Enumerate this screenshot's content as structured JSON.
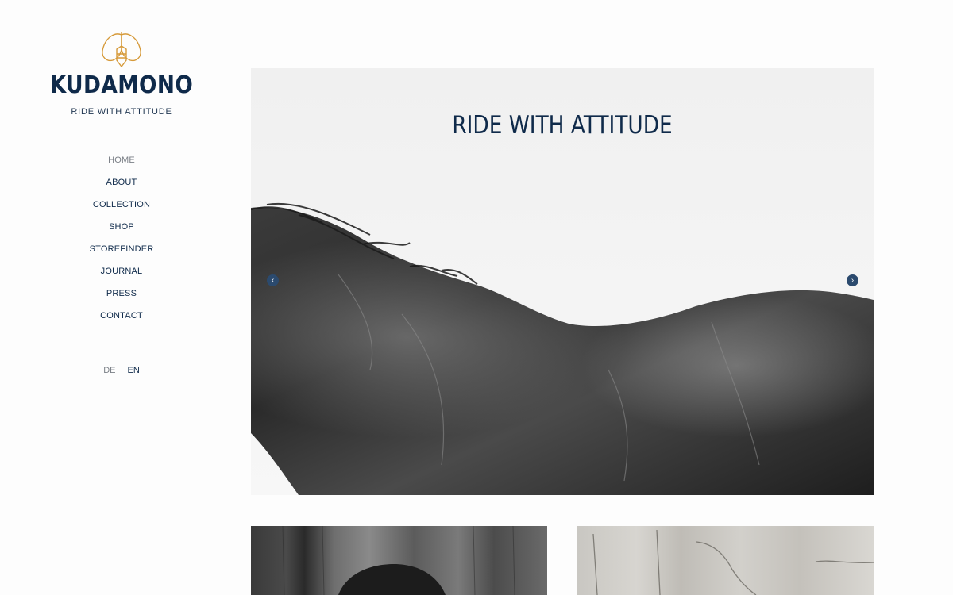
{
  "brand": {
    "name": "KUDAMONO",
    "tagline": "RIDE WITH ATTITUDE",
    "logo_icon": "bee-logo-icon",
    "logo_color": "#d69a3a",
    "brand_color": "#0f2a4a"
  },
  "nav": {
    "items": [
      {
        "label": "HOME",
        "active": true
      },
      {
        "label": "ABOUT"
      },
      {
        "label": "COLLECTION"
      },
      {
        "label": "SHOP"
      },
      {
        "label": "STOREFINDER"
      },
      {
        "label": "JOURNAL"
      },
      {
        "label": "PRESS"
      },
      {
        "label": "CONTACT"
      }
    ]
  },
  "language": {
    "options": [
      "DE",
      "EN"
    ],
    "selected": "EN"
  },
  "hero": {
    "title": "RIDE WITH ATTITUDE",
    "image": "black-horse-photo",
    "prev_icon": "chevron-left-icon",
    "next_icon": "chevron-right-icon"
  },
  "tiles": [
    {
      "image": "wooden-wall-photo"
    },
    {
      "image": "weathered-wood-photo"
    }
  ]
}
